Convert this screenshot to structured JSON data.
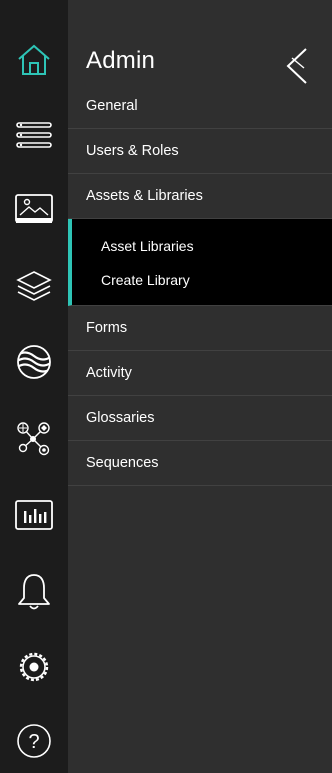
{
  "colors": {
    "accent": "#2ec4b6",
    "rail_background": "#1c1c1c",
    "panel_background": "#2f2f2f",
    "submenu_background": "#000000",
    "divider": "#414141"
  },
  "rail": {
    "items": [
      {
        "icon": "home-icon",
        "active": true
      },
      {
        "icon": "list-icon",
        "active": false
      },
      {
        "icon": "image-icon",
        "active": false
      },
      {
        "icon": "layers-icon",
        "active": false
      },
      {
        "icon": "waves-icon",
        "active": false
      },
      {
        "icon": "network-icon",
        "active": false
      },
      {
        "icon": "bar-chart-icon",
        "active": false
      },
      {
        "icon": "bell-icon",
        "active": false
      },
      {
        "icon": "settings-gear-icon",
        "active": false
      },
      {
        "icon": "help-icon",
        "active": false
      }
    ]
  },
  "panel": {
    "title": "Admin",
    "collapse_icon": "chevron-left-icon",
    "menu": [
      {
        "label": "General"
      },
      {
        "label": "Users & Roles"
      },
      {
        "label": "Assets & Libraries",
        "expanded": true
      }
    ],
    "submenu": [
      {
        "label": "Asset Libraries"
      },
      {
        "label": "Create Library"
      }
    ],
    "menu_after": [
      {
        "label": "Forms"
      },
      {
        "label": "Activity"
      },
      {
        "label": "Glossaries"
      },
      {
        "label": "Sequences"
      }
    ]
  }
}
